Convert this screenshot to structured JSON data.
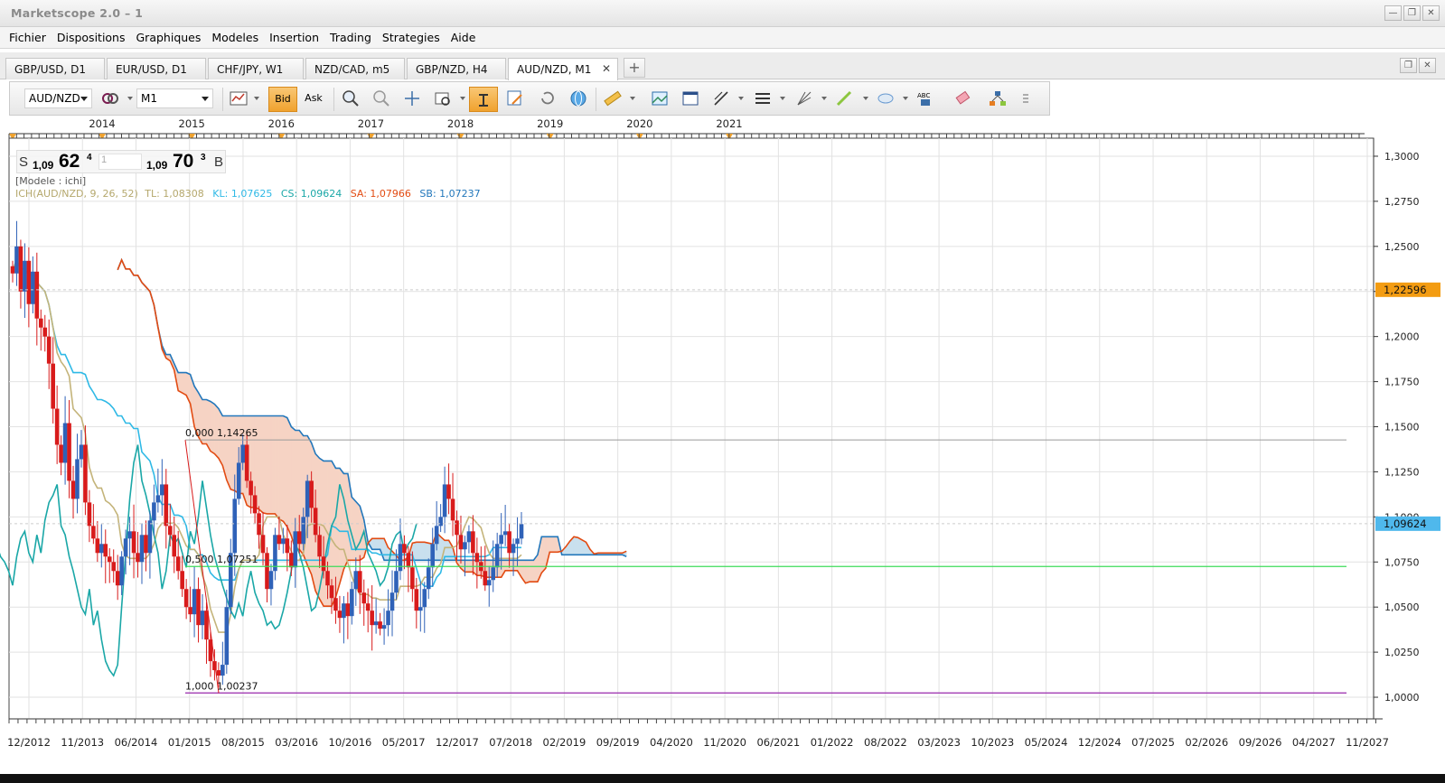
{
  "app": {
    "title": "Marketscope 2.0 – 1"
  },
  "menu": [
    "Fichier",
    "Dispositions",
    "Graphiques",
    "Modeles",
    "Insertion",
    "Trading",
    "Strategies",
    "Aide"
  ],
  "tabs": [
    {
      "label": "GBP/USD, D1",
      "active": false
    },
    {
      "label": "EUR/USD, D1",
      "active": false
    },
    {
      "label": "CHF/JPY, W1",
      "active": false
    },
    {
      "label": "NZD/CAD, m5",
      "active": false
    },
    {
      "label": "GBP/NZD, H4",
      "active": false
    },
    {
      "label": "AUD/NZD, M1",
      "active": true
    }
  ],
  "toolbar": {
    "symbol": "AUD/NZD",
    "timeframe": "M1",
    "bid_label": "Bid",
    "ask_label": "Ask"
  },
  "quote": {
    "sell_label": "S",
    "sell_prefix": "1,09",
    "sell_big": "62",
    "sell_sup": "4",
    "amount": "1",
    "buy_prefix": "1,09",
    "buy_big": "70",
    "buy_sup": "3",
    "buy_label": "B"
  },
  "indicator": {
    "model_label": "[Modele : ichi]",
    "name": "ICH(AUD/NZD, 9, 26, 52)",
    "tl": "TL: 1,08308",
    "kl": "KL: 1,07625",
    "cs": "CS: 1,09624",
    "sa": "SA: 1,07966",
    "sb": "SB: 1,07237"
  },
  "fibonacci": [
    {
      "label": "0,000 1,14265",
      "price": 1.14265
    },
    {
      "label": "0,500 1,07251",
      "price": 1.07251
    },
    {
      "label": "1,000 1,00237",
      "price": 1.00237
    }
  ],
  "price_markers": [
    {
      "label": "1,22596",
      "value": 1.22596,
      "color": "#f39c12"
    },
    {
      "label": "1,09624",
      "value": 1.09624,
      "color": "#4fb8ec"
    }
  ],
  "chart_data": {
    "type": "candlestick",
    "title": "",
    "y_axis_ticks": [
      "1,3000",
      "1,2750",
      "1,2500",
      "1,2250",
      "1,2000",
      "1,1750",
      "1,1500",
      "1,1250",
      "1,1000",
      "1,0750",
      "1,0500",
      "1,0250",
      "1,0000"
    ],
    "ylim": [
      0.988,
      1.31
    ],
    "top_axis_years": [
      "2014",
      "2015",
      "2016",
      "2017",
      "2018",
      "2019",
      "2020",
      "2021"
    ],
    "x_axis_labels": [
      "12/2012",
      "11/2013",
      "06/2014",
      "01/2015",
      "08/2015",
      "03/2016",
      "10/2016",
      "05/2017",
      "12/2017",
      "07/2018",
      "02/2019",
      "09/2019",
      "04/2020",
      "11/2020",
      "06/2021",
      "01/2022",
      "08/2022",
      "03/2023",
      "10/2023",
      "05/2024",
      "12/2024",
      "07/2025",
      "02/2026",
      "09/2026",
      "04/2027",
      "11/2027"
    ],
    "closes": [
      1.235,
      1.25,
      1.225,
      1.242,
      1.218,
      1.236,
      1.21,
      1.205,
      1.2,
      1.185,
      1.16,
      1.14,
      1.13,
      1.152,
      1.12,
      1.11,
      1.132,
      1.14,
      1.108,
      1.095,
      1.088,
      1.08,
      1.085,
      1.078,
      1.075,
      1.07,
      1.062,
      1.078,
      1.088,
      1.092,
      1.08,
      1.075,
      1.09,
      1.08,
      1.098,
      1.108,
      1.112,
      1.118,
      1.095,
      1.09,
      1.078,
      1.07,
      1.06,
      1.05,
      1.046,
      1.06,
      1.04,
      1.048,
      1.032,
      1.02,
      1.015,
      1.012,
      1.018,
      1.05,
      1.08,
      1.11,
      1.13,
      1.14,
      1.12,
      1.112,
      1.102,
      1.09,
      1.08,
      1.06,
      1.07,
      1.09,
      1.085,
      1.088,
      1.08,
      1.072,
      1.092,
      1.085,
      1.1,
      1.12,
      1.105,
      1.09,
      1.078,
      1.07,
      1.062,
      1.055,
      1.048,
      1.044,
      1.052,
      1.045,
      1.06,
      1.07,
      1.058,
      1.052,
      1.048,
      1.04,
      1.042,
      1.038,
      1.04,
      1.048,
      1.058,
      1.07,
      1.085,
      1.08,
      1.072,
      1.06,
      1.048,
      1.05,
      1.06,
      1.072,
      1.085,
      1.095,
      1.1,
      1.118,
      1.11,
      1.098,
      1.09,
      1.082,
      1.086,
      1.092,
      1.08,
      1.075,
      1.07,
      1.062,
      1.065,
      1.072,
      1.085,
      1.09,
      1.092,
      1.08,
      1.085,
      1.088,
      1.096
    ],
    "series": [
      {
        "name": "TL"
      },
      {
        "name": "KL"
      },
      {
        "name": "CS"
      },
      {
        "name": "SA"
      },
      {
        "name": "SB"
      }
    ],
    "colors": {
      "up": "#2f62b8",
      "down": "#d81b1b",
      "tenkan": "#c4b47a",
      "kijun": "#2fb9e6",
      "chikou": "#1aa7a7",
      "senkou_a": "#e24b12",
      "senkou_b": "#2277bb",
      "kumo_bull": "#c9e0ee",
      "kumo_bear": "#f6d3c4"
    }
  }
}
